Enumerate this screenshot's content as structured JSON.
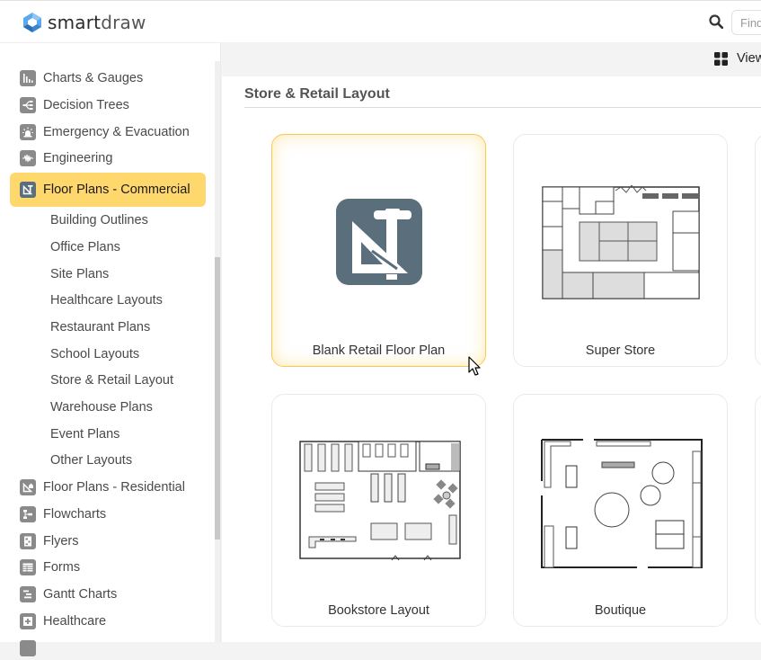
{
  "app": {
    "logo_bold": "smart",
    "logo_light": "draw",
    "brand_colors": {
      "logo_light_blue": "#5aa9f0",
      "logo_dark_blue": "#2b6fb6"
    }
  },
  "header": {
    "search_icon": "search-icon",
    "find_placeholder": "Find"
  },
  "toolbar": {
    "view_label": "View",
    "view_icon": "grid-icon"
  },
  "sidebar": {
    "categories_top": [
      {
        "label": "Charts & Gauges",
        "icon": "bar-chart-icon"
      },
      {
        "label": "Decision Trees",
        "icon": "decision-tree-icon"
      },
      {
        "label": "Emergency & Evacuation",
        "icon": "alarm-icon"
      },
      {
        "label": "Engineering",
        "icon": "waveform-icon"
      }
    ],
    "active_category": {
      "label": "Floor Plans - Commercial",
      "icon": "floor-plan-icon",
      "highlight": "#fed76d"
    },
    "subcategories": [
      "Building Outlines",
      "Office Plans",
      "Site Plans",
      "Healthcare Layouts",
      "Restaurant Plans",
      "School Layouts",
      "Store & Retail Layout",
      "Warehouse Plans",
      "Event Plans",
      "Other Layouts"
    ],
    "categories_bottom": [
      {
        "label": "Floor Plans - Residential",
        "icon": "residential-plan-icon"
      },
      {
        "label": "Flowcharts",
        "icon": "flowchart-icon"
      },
      {
        "label": "Flyers",
        "icon": "flyer-icon"
      },
      {
        "label": "Forms",
        "icon": "form-icon"
      },
      {
        "label": "Gantt Charts",
        "icon": "gantt-icon"
      },
      {
        "label": "Healthcare",
        "icon": "healthcare-icon"
      }
    ]
  },
  "main": {
    "section_title": "Store & Retail Layout",
    "templates": [
      {
        "label": "Blank Retail Floor Plan",
        "selected": true
      },
      {
        "label": "Super Store",
        "selected": false
      },
      {
        "label": "Bookstore Layout",
        "selected": false
      },
      {
        "label": "Boutique",
        "selected": false
      }
    ]
  }
}
